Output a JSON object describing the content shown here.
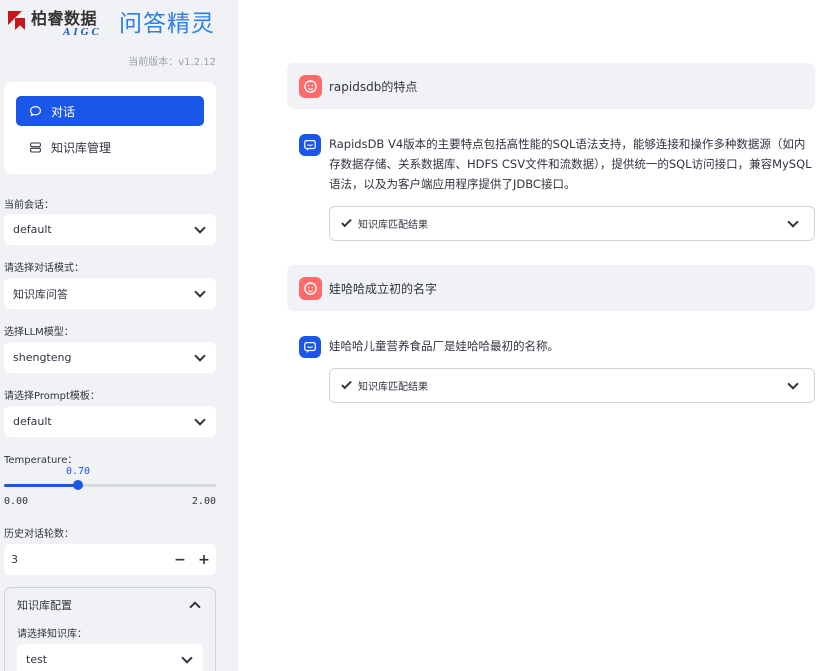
{
  "sidebar": {
    "logo_text": "柏睿数据",
    "logo_sub": "AIGC",
    "app_title": "问答精灵",
    "version": "当前版本：v1.2.12",
    "menu": [
      {
        "label": "对话",
        "icon": "chat-bubble-icon",
        "active": true
      },
      {
        "label": "知识库管理",
        "icon": "database-icon",
        "active": false
      }
    ],
    "session_label": "当前会话：",
    "session_value": "default",
    "mode_label": "请选择对话模式：",
    "mode_value": "知识库问答",
    "llm_label": "选择LLM模型：",
    "llm_value": "shengteng",
    "prompt_label": "请选择Prompt模板：",
    "prompt_value": "default",
    "temperature": {
      "label": "Temperature：",
      "value": "0.70",
      "min": "0.00",
      "max": "2.00",
      "fraction": 0.35
    },
    "history_label": "历史对话轮数：",
    "history_value": "3",
    "minus": "−",
    "plus": "+",
    "kb_config": {
      "title": "知识库配置",
      "select_label": "请选择知识库：",
      "select_value": "test"
    }
  },
  "chat": [
    {
      "question": "rapidsdb的特点",
      "answer": "RapidsDB V4版本的主要特点包括高性能的SQL语法支持，能够连接和操作多种数据源（如内存数据存储、关系数据库、HDFS CSV文件和流数据），提供统一的SQL访问接口，兼容MySQL语法，以及为客户端应用程序提供了JDBC接口。",
      "kb_label": "知识库匹配结果"
    },
    {
      "question": "娃哈哈成立初的名字",
      "answer": "娃哈哈儿童营养食品厂是娃哈哈最初的名称。",
      "kb_label": "知识库匹配结果"
    }
  ],
  "colors": {
    "accent": "#1a56e8",
    "user_avatar": "#ff6b6b",
    "sidebar_bg": "#f0f2f6",
    "logo_red": "#c8161d",
    "app_title": "#2b7fe5"
  }
}
